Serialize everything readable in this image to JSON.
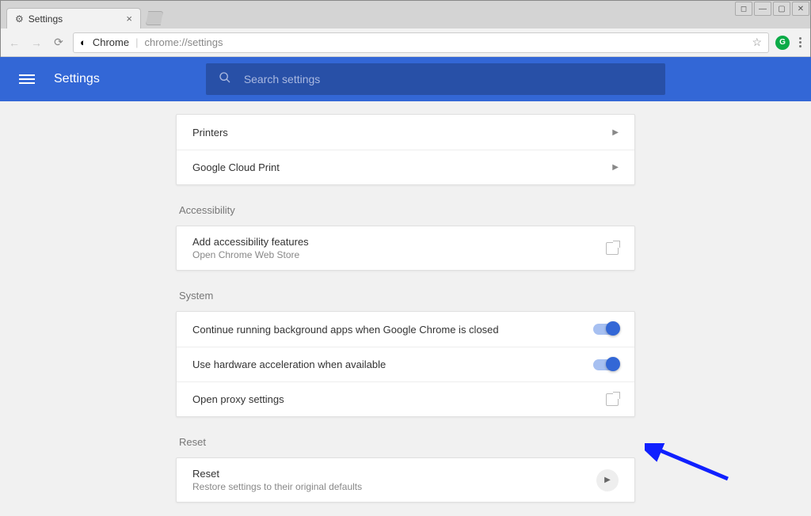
{
  "window": {
    "tab_title": "Settings"
  },
  "omnibox": {
    "origin_label": "Chrome",
    "url_path": "chrome://settings"
  },
  "header": {
    "title": "Settings",
    "search_placeholder": "Search settings"
  },
  "sections": {
    "printing": {
      "rows": [
        {
          "title": "Printers"
        },
        {
          "title": "Google Cloud Print"
        }
      ]
    },
    "accessibility": {
      "label": "Accessibility",
      "row": {
        "title": "Add accessibility features",
        "sub": "Open Chrome Web Store"
      }
    },
    "system": {
      "label": "System",
      "rows": [
        {
          "title": "Continue running background apps when Google Chrome is closed",
          "toggle": true
        },
        {
          "title": "Use hardware acceleration when available",
          "toggle": true
        },
        {
          "title": "Open proxy settings"
        }
      ]
    },
    "reset": {
      "label": "Reset",
      "row": {
        "title": "Reset",
        "sub": "Restore settings to their original defaults"
      }
    }
  }
}
